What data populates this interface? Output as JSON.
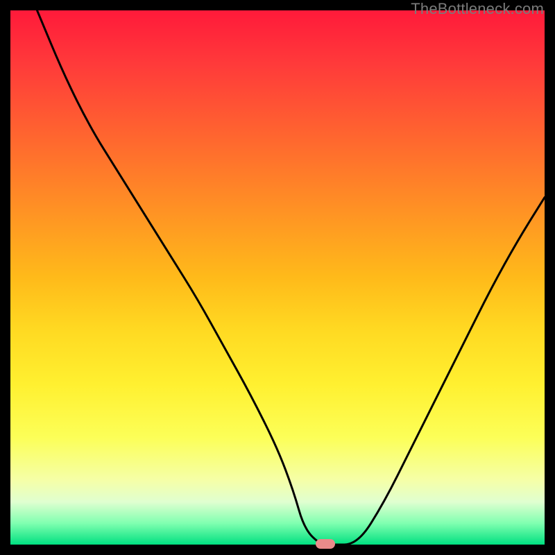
{
  "watermark": "TheBottleneck.com",
  "chart_data": {
    "type": "line",
    "title": "",
    "xlabel": "",
    "ylabel": "",
    "xlim": [
      0,
      100
    ],
    "ylim": [
      0,
      100
    ],
    "series": [
      {
        "name": "curve",
        "x": [
          5,
          10,
          15,
          20,
          25,
          30,
          35,
          40,
          45,
          50,
          53,
          55,
          58,
          60,
          65,
          70,
          75,
          80,
          85,
          90,
          95,
          100
        ],
        "values": [
          100,
          88,
          78,
          70,
          62,
          54,
          46,
          37,
          28,
          18,
          10,
          3,
          0,
          0,
          0,
          8,
          18,
          28,
          38,
          48,
          57,
          65
        ]
      }
    ],
    "marker": {
      "x": 59,
      "y": 0
    },
    "gradient_bands": [
      {
        "pos": 0,
        "color": "#ff1a3a"
      },
      {
        "pos": 50,
        "color": "#ffba1a"
      },
      {
        "pos": 80,
        "color": "#fcff58"
      },
      {
        "pos": 100,
        "color": "#00e080"
      }
    ]
  }
}
